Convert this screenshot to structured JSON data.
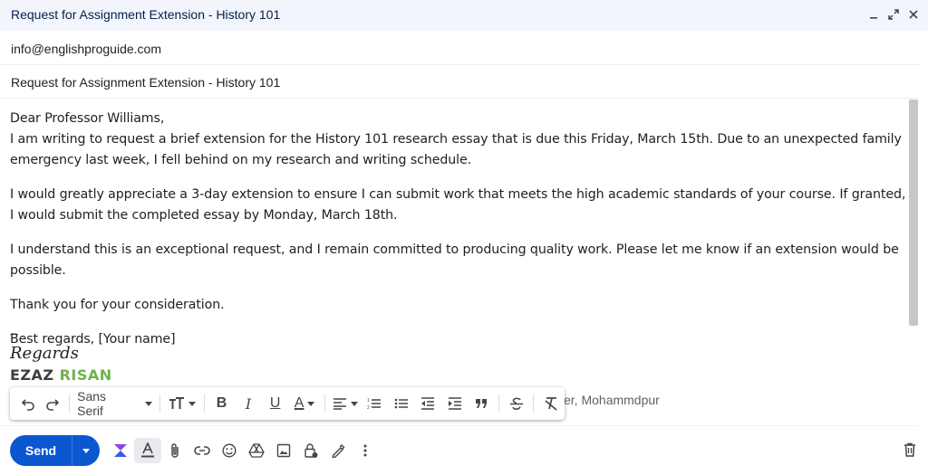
{
  "window": {
    "title": "Request for Assignment Extension - History 101"
  },
  "fields": {
    "to": "info@englishproguide.com",
    "subject": "Request for Assignment Extension - History 101"
  },
  "body": {
    "greeting": "Dear Professor Williams,",
    "para1": "I am writing to request a brief extension for the History 101 research essay that is due this Friday, March 15th. Due to an unexpected family emergency last week, I fell behind on my research and writing schedule.",
    "para2": "I would greatly appreciate a 3-day extension to ensure I can submit work that meets the high academic standards of your course. If granted, I would submit the completed essay by Monday, March 18th.",
    "para3": "I understand this is an exceptional request, and I remain committed to producing quality work. Please let me know if an extension would be possible.",
    "para4": "Thank you for your consideration.",
    "closing": "Best regards, [Your name]"
  },
  "signature": {
    "dash": "--",
    "regards": "Regards",
    "name_first": "EZAZ",
    "name_last": "RISAN",
    "partial_line": "er, Mohammdpur"
  },
  "format_bar": {
    "font": "Sans Serif",
    "bold": "B",
    "italic": "I",
    "underline": "U",
    "text_color": "A"
  },
  "bottom": {
    "send_label": "Send"
  },
  "colors": {
    "send_button": "#0b57d0",
    "title_bar": "#f2f6fc",
    "signature_last_name": "#6fb24a"
  }
}
